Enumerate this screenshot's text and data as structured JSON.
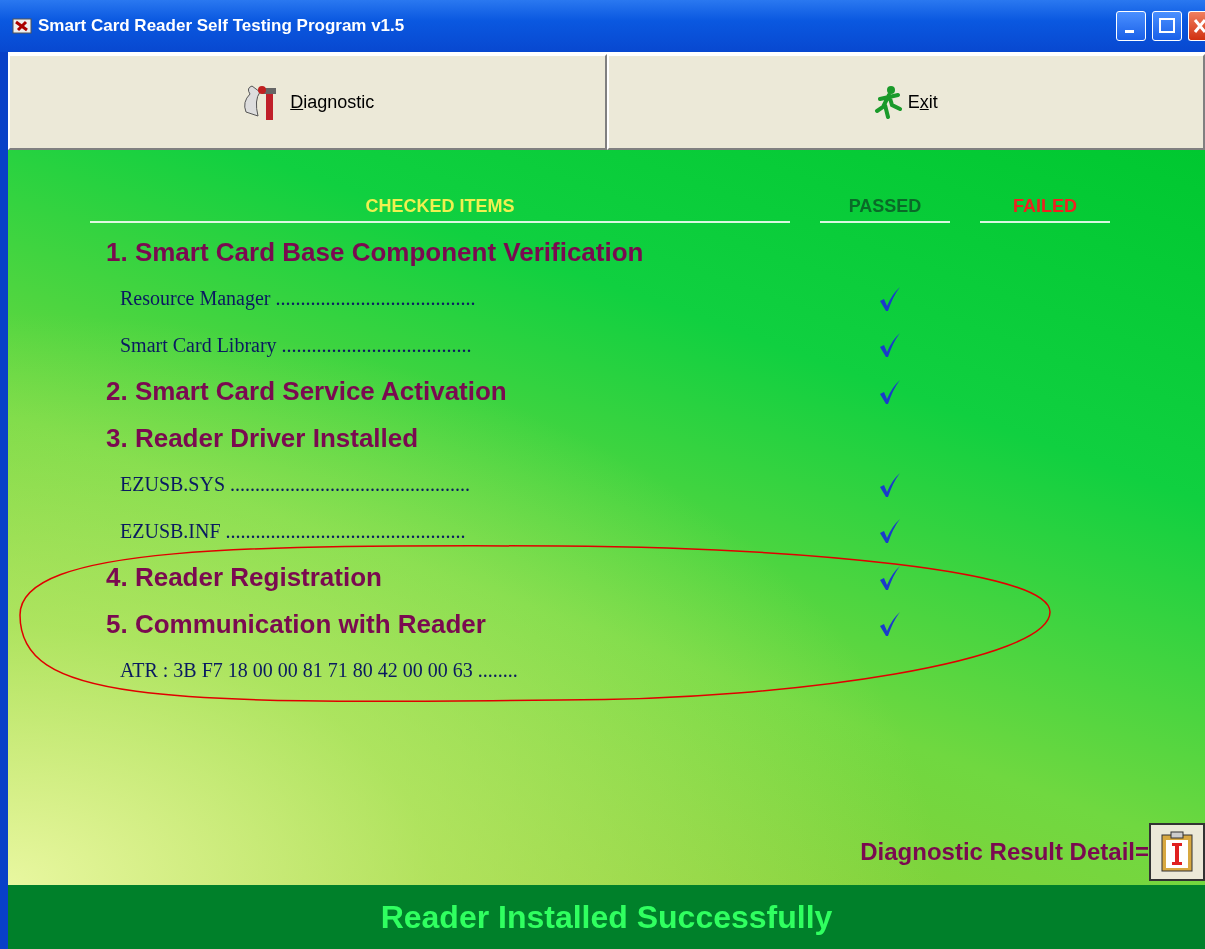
{
  "window": {
    "title": "Smart Card Reader Self Testing Program v1.5"
  },
  "toolbar": [
    {
      "kind": "diagnostic",
      "label_key": "D",
      "label_after": "iagnostic"
    },
    {
      "kind": "exit",
      "label_before": "E",
      "label_key": "x",
      "label_after": "it"
    }
  ],
  "columns": {
    "checked_items": "CHECKED ITEMS",
    "passed": "PASSED",
    "failed": "FAILED"
  },
  "rows": [
    {
      "kind": "section",
      "text": "1. Smart Card Base Component Verification",
      "passed": false
    },
    {
      "kind": "sub",
      "text": "Resource Manager ........................................",
      "passed": true
    },
    {
      "kind": "sub",
      "text": "Smart Card Library ......................................",
      "passed": true
    },
    {
      "kind": "section",
      "text": "2. Smart Card Service Activation",
      "passed": true
    },
    {
      "kind": "section",
      "text": "3. Reader Driver Installed",
      "passed": false
    },
    {
      "kind": "sub",
      "text": "EZUSB.SYS ................................................",
      "passed": true
    },
    {
      "kind": "sub",
      "text": "EZUSB.INF ................................................",
      "passed": true
    },
    {
      "kind": "section",
      "text": "4. Reader Registration",
      "passed": true
    },
    {
      "kind": "section",
      "text": "5. Communication with Reader",
      "passed": true
    },
    {
      "kind": "sub",
      "text": "ATR : 3B F7 18 00 00 81 71 80 42 00 00 63 ........",
      "passed": false
    }
  ],
  "result_detail": {
    "label": "Diagnostic Result Detail="
  },
  "status_bar": "Reader Installed Successfully"
}
